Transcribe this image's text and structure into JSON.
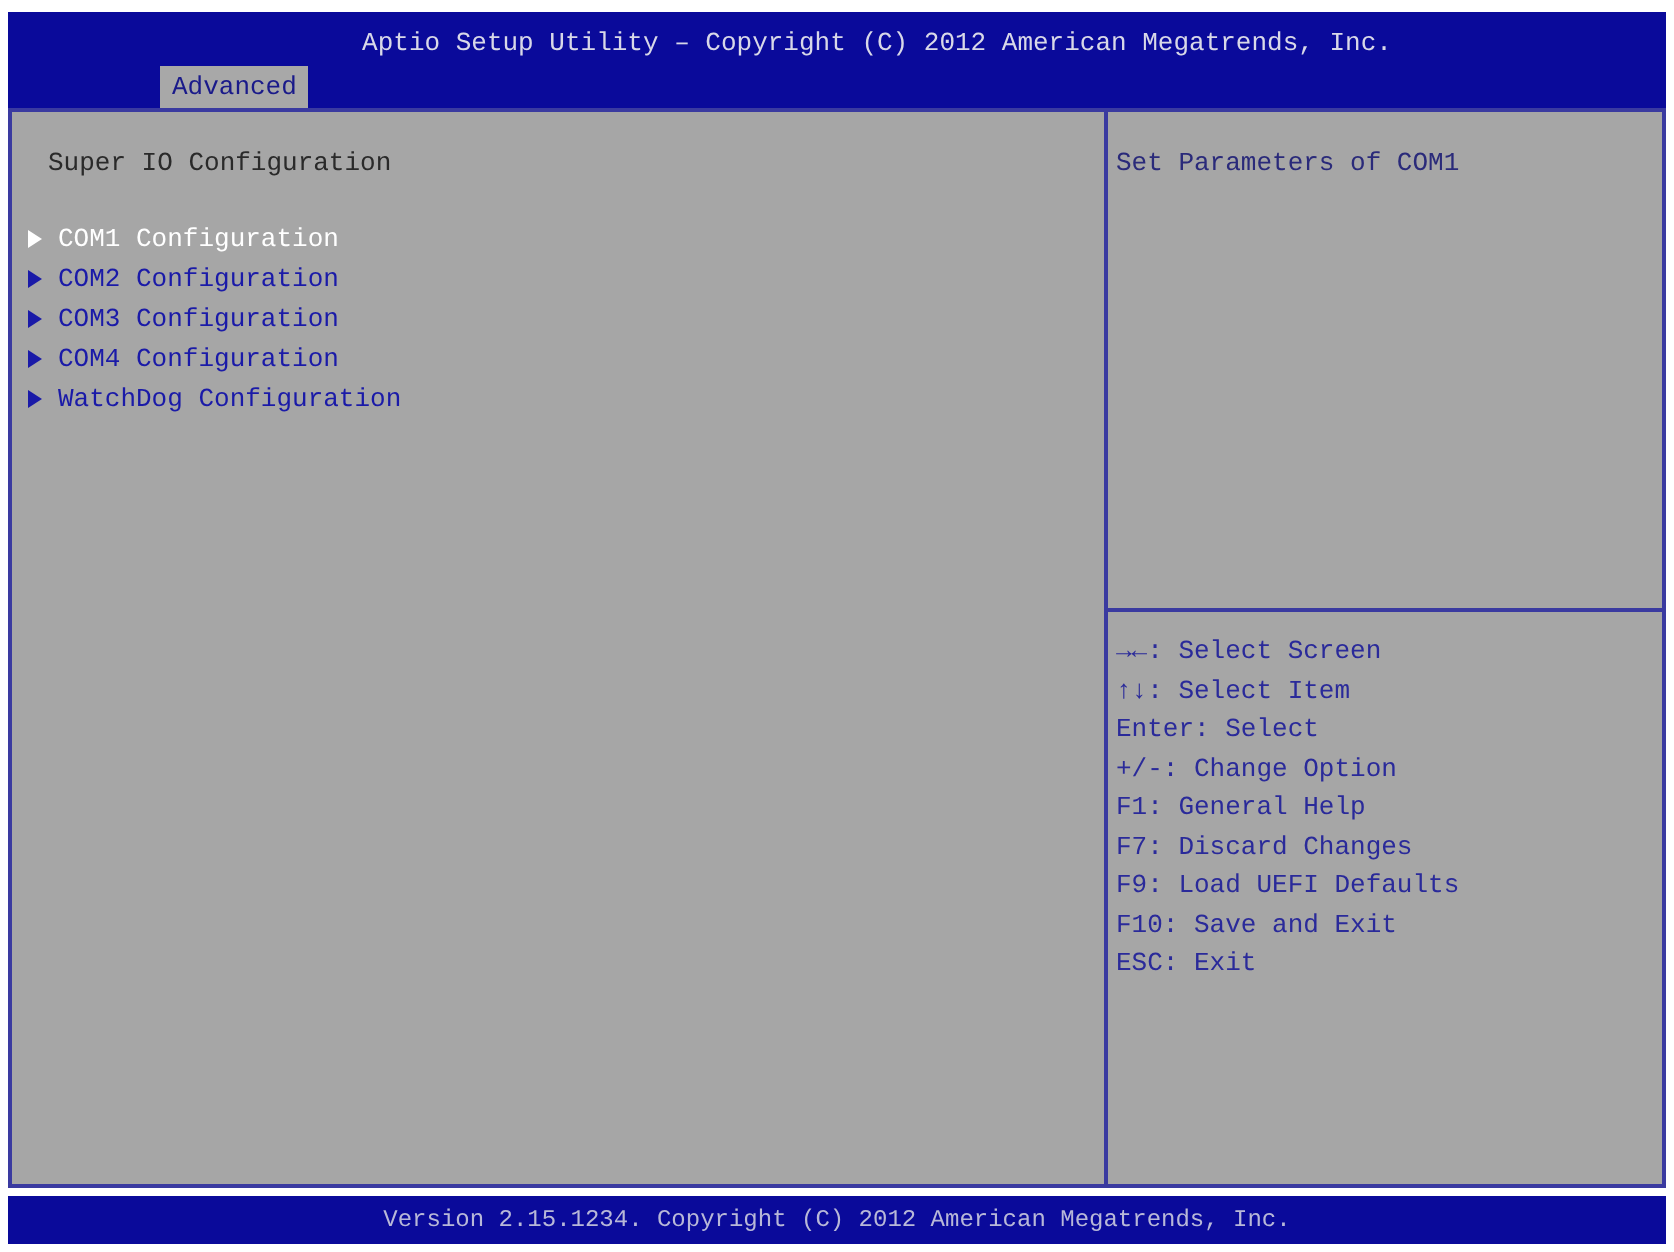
{
  "header": {
    "title": "Aptio Setup Utility – Copyright (C) 2012 American Megatrends, Inc.",
    "tabs": [
      {
        "label": "Advanced",
        "selected": true
      }
    ]
  },
  "main": {
    "heading": "Super IO Configuration",
    "items": [
      {
        "label": "COM1 Configuration",
        "selected": true
      },
      {
        "label": "COM2 Configuration",
        "selected": false
      },
      {
        "label": "COM3 Configuration",
        "selected": false
      },
      {
        "label": "COM4 Configuration",
        "selected": false
      },
      {
        "label": "WatchDog Configuration",
        "selected": false
      }
    ]
  },
  "help": {
    "text": "Set Parameters of COM1"
  },
  "keys": [
    "→←: Select Screen",
    "↑↓: Select Item",
    "Enter: Select",
    "+/-: Change Option",
    "F1: General Help",
    "F7: Discard Changes",
    "F9: Load UEFI Defaults",
    "F10: Save and Exit",
    "ESC: Exit"
  ],
  "footer": {
    "text": "Version 2.15.1234. Copyright (C) 2012 American Megatrends, Inc."
  }
}
